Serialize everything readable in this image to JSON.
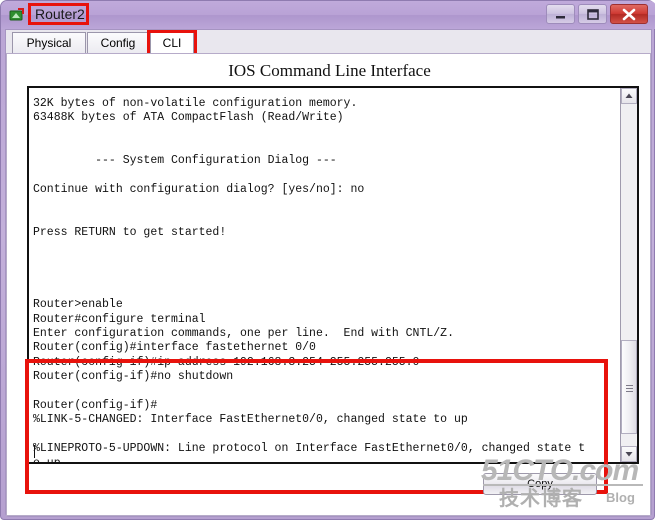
{
  "window": {
    "title": "Router2",
    "icon": "router-device-icon",
    "ghost_title": "",
    "controls": {
      "minimize": "minimize-icon",
      "maximize": "maximize-icon",
      "close": "close-icon"
    }
  },
  "tabs": [
    {
      "label": "Physical",
      "active": false
    },
    {
      "label": "Config",
      "active": false
    },
    {
      "label": "CLI",
      "active": true
    }
  ],
  "panel": {
    "title": "IOS Command Line Interface"
  },
  "terminal": {
    "content": "32K bytes of non-volatile configuration memory.\n63488K bytes of ATA CompactFlash (Read/Write)\n\n\n         --- System Configuration Dialog ---\n\nContinue with configuration dialog? [yes/no]: no\n\n\nPress RETURN to get started!\n\n\n\n\nRouter>enable\nRouter#configure terminal\nEnter configuration commands, one per line.  End with CNTL/Z.\nRouter(config)#interface fastethernet 0/0\nRouter(config-if)#ip address 192.168.3.254 255.255.255.0\nRouter(config-if)#no shutdown\n\nRouter(config-if)#\n%LINK-5-CHANGED: Interface FastEthernet0/0, changed state to up\n\n%LINEPROTO-5-UPDOWN: Line protocol on Interface FastEthernet0/0, changed state t\no up\n",
    "lines": [
      "32K bytes of non-volatile configuration memory.",
      "63488K bytes of ATA CompactFlash (Read/Write)",
      "",
      "",
      "         --- System Configuration Dialog ---",
      "",
      "Continue with configuration dialog? [yes/no]: no",
      "",
      "",
      "Press RETURN to get started!",
      "",
      "",
      "",
      "",
      "Router>enable",
      "Router#configure terminal",
      "Enter configuration commands, one per line.  End with CNTL/Z.",
      "Router(config)#interface fastethernet 0/0",
      "Router(config-if)#ip address 192.168.3.254 255.255.255.0",
      "Router(config-if)#no shutdown",
      "",
      "Router(config-if)#",
      "%LINK-5-CHANGED: Interface FastEthernet0/0, changed state to up",
      "",
      "%LINEPROTO-5-UPDOWN: Line protocol on Interface FastEthernet0/0, changed state t",
      "o up"
    ]
  },
  "copy_button": {
    "label": "Copy"
  },
  "annotations": {
    "highlight_color": "#e8120c"
  },
  "watermark": {
    "main": "51CTO.com",
    "chinese": "技术博客",
    "blog": "Blog"
  }
}
